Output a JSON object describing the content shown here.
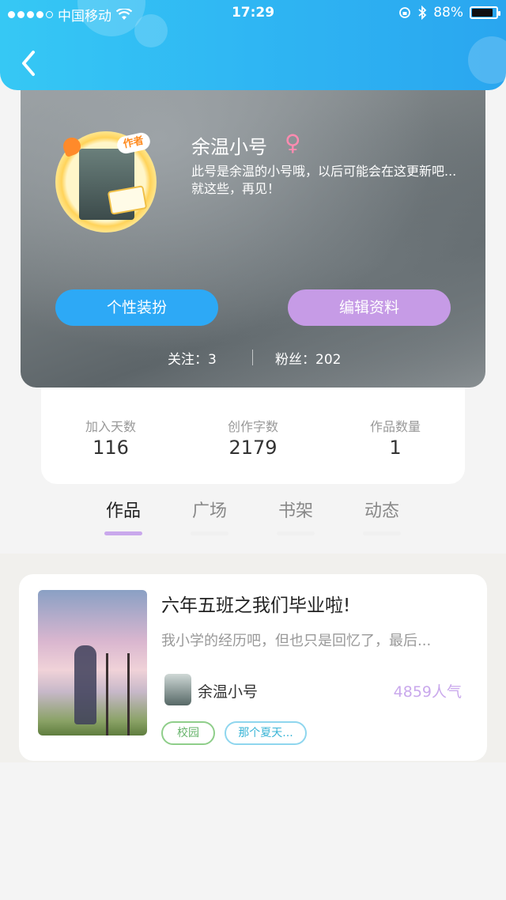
{
  "status_bar": {
    "carrier": "中国移动",
    "time": "17:29",
    "battery": "88%",
    "battery_level": 0.88
  },
  "header": {
    "back_icon": "chevron-left-icon"
  },
  "profile": {
    "avatar_badge": "作者",
    "username": "余温小号",
    "gender_icon": "female-icon",
    "bio": "此号是余温的小号哦，以后可能会在这更新吧...就这些，再见！",
    "buttons": {
      "dress_up": "个性装扮",
      "edit_profile": "编辑资料"
    },
    "following_label": "关注：3",
    "followers_label": "粉丝：202"
  },
  "stats": [
    {
      "label": "加入天数",
      "value": "116"
    },
    {
      "label": "创作字数",
      "value": "2179"
    },
    {
      "label": "作品数量",
      "value": "1"
    }
  ],
  "tabs": [
    {
      "label": "作品",
      "active": true
    },
    {
      "label": "广场",
      "active": false
    },
    {
      "label": "书架",
      "active": false
    },
    {
      "label": "动态",
      "active": false
    }
  ],
  "works": [
    {
      "title": "六年五班之我们毕业啦!",
      "description": "我小学的经历吧，但也只是回忆了，最后...",
      "author": "余温小号",
      "popularity": "4859人气",
      "tags": [
        "校园",
        "那个夏天..."
      ]
    }
  ],
  "colors": {
    "header": "#2fb6f3",
    "dress_button": "#2da9f6",
    "edit_button": "#c69be6",
    "popularity": "#c9a8ec",
    "tab_active_underline": "#c9a8ec"
  }
}
